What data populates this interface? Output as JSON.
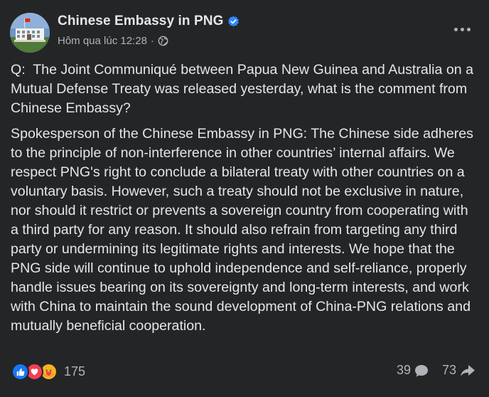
{
  "post": {
    "page_name": "Chinese Embassy in PNG",
    "timestamp": "Hôm qua lúc 12:28",
    "separator": "·",
    "privacy_icon": "globe-icon",
    "verified_icon": "verified-badge-icon",
    "more_icon": "more-options-icon",
    "paragraphs": [
      "Q:  The Joint Communiqué between Papua New Guinea and Australia on a Mutual Defense Treaty was released yesterday, what is the comment from Chinese Embassy?",
      "Spokesperson of the Chinese Embassy in PNG: The Chinese side adheres to the principle of non-interference in other countries’ internal affairs. We respect PNG's right to conclude a bilateral treaty with other countries on a voluntary basis. However, such a treaty should not be exclusive in nature, nor should it restrict or prevents a sovereign country from cooperating with a third party for any reason. It should also refrain from targeting any third party or undermining its legitimate rights and interests. We hope that the PNG side will continue to uphold independence and self-reliance, properly handle issues bearing on its sovereignty and long-term interests, and work with China to maintain the sound development of China-PNG relations and mutually beneficial cooperation."
    ]
  },
  "footer": {
    "reactions": [
      "like-icon",
      "love-icon",
      "care-icon"
    ],
    "reaction_count": "175",
    "comment_count": "39",
    "share_count": "73"
  },
  "colors": {
    "background": "#242526",
    "text": "#e4e6eb",
    "secondary": "#b0b3b8",
    "verified": "#2d88ff",
    "like": "#1877f2",
    "love": "#f33e58",
    "care": "#f7b125"
  }
}
